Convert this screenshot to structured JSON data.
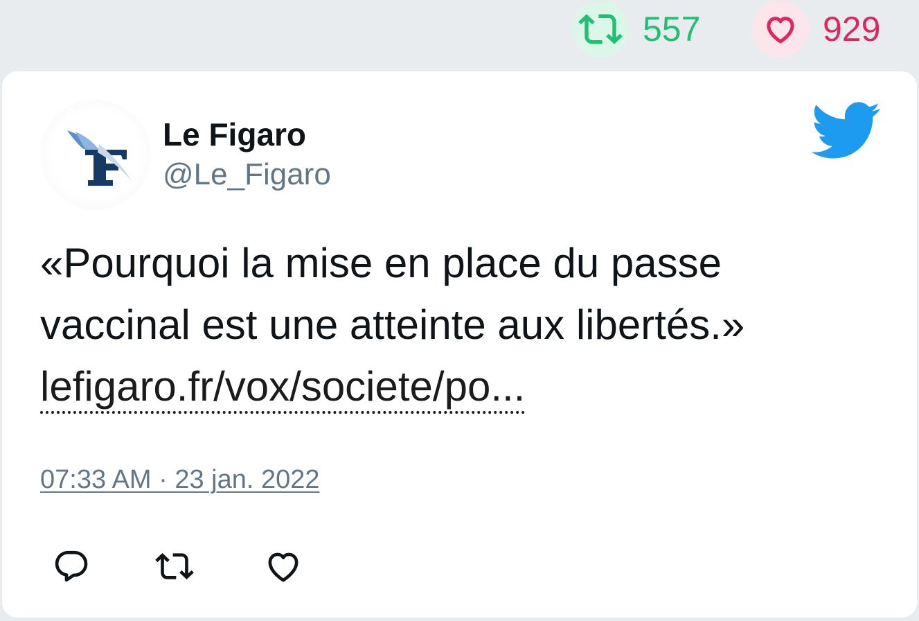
{
  "stats": {
    "retweet_icon": "retweet-icon",
    "retweet_count": "557",
    "retweet_color": "#1fbf74",
    "like_icon": "heart-icon",
    "like_count": "929",
    "like_color": "#e0245e"
  },
  "tweet": {
    "author_name": "Le Figaro",
    "author_handle": "@Le_Figaro",
    "avatar_icon": "le-figaro-logo",
    "platform_icon": "twitter-bird-icon",
    "text_lines": [
      "«Pourquoi la mise en place du passe",
      "vaccinal est une atteinte aux libertés.»"
    ],
    "link_text": "lefigaro.fr/vox/societe/po...",
    "timestamp": "07:33 AM · 23 jan. 2022"
  },
  "actions": [
    {
      "icon": "reply-icon"
    },
    {
      "icon": "retweet-icon"
    },
    {
      "icon": "like-icon"
    }
  ],
  "colors": {
    "background": "#e9ecef",
    "card": "#ffffff",
    "twitter_blue": "#1d9bf0",
    "muted_text": "#637686"
  }
}
